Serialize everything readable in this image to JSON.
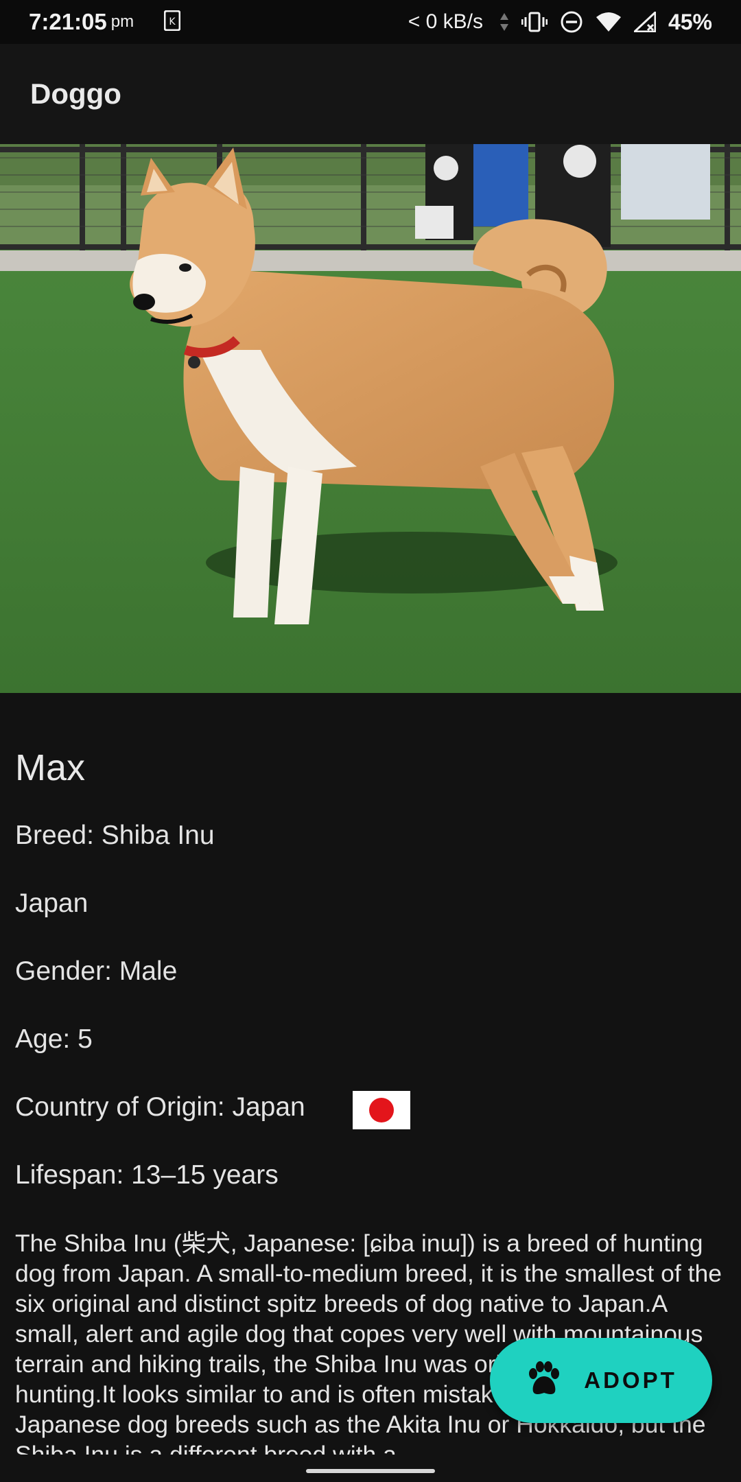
{
  "status_bar": {
    "time": "7:21:05",
    "ampm": "pm",
    "network_speed": "< 0 kB/s",
    "battery": "45%",
    "icons": [
      "app-notification-icon",
      "vibrate-icon",
      "dnd-icon",
      "wifi-icon",
      "signal-icon"
    ]
  },
  "app_bar": {
    "title": "Doggo"
  },
  "hero": {
    "icon": "shiba-inu-photo"
  },
  "dog": {
    "name": "Max",
    "breed": "Breed: Shiba Inu",
    "region": "Japan",
    "gender": "Gender: Male",
    "age": "Age: 5",
    "origin": "Country of Origin: Japan",
    "lifespan": "Lifespan: 13–15 years",
    "description": "The Shiba Inu (柴犬, Japanese: [ɕiba inɯ]) is a breed of hunting dog from Japan. A small-to-medium breed, it is the smallest of the six original and distinct spitz breeds of dog native to Japan.A small, alert and agile dog that copes very well with mountainous terrain and hiking trails, the Shiba Inu was originally bred for hunting.It looks similar to and is often mistaken for other Japanese dog breeds such as the Akita Inu or Hokkaido, but the Shiba Inu is a different breed with a"
  },
  "flag": {
    "icon": "japan-flag-icon",
    "colors": {
      "field": "#ffffff",
      "disc": "#e3151b"
    }
  },
  "fab": {
    "label": "ADOPT",
    "icon": "paw-icon",
    "color": "#1fd1c0"
  }
}
